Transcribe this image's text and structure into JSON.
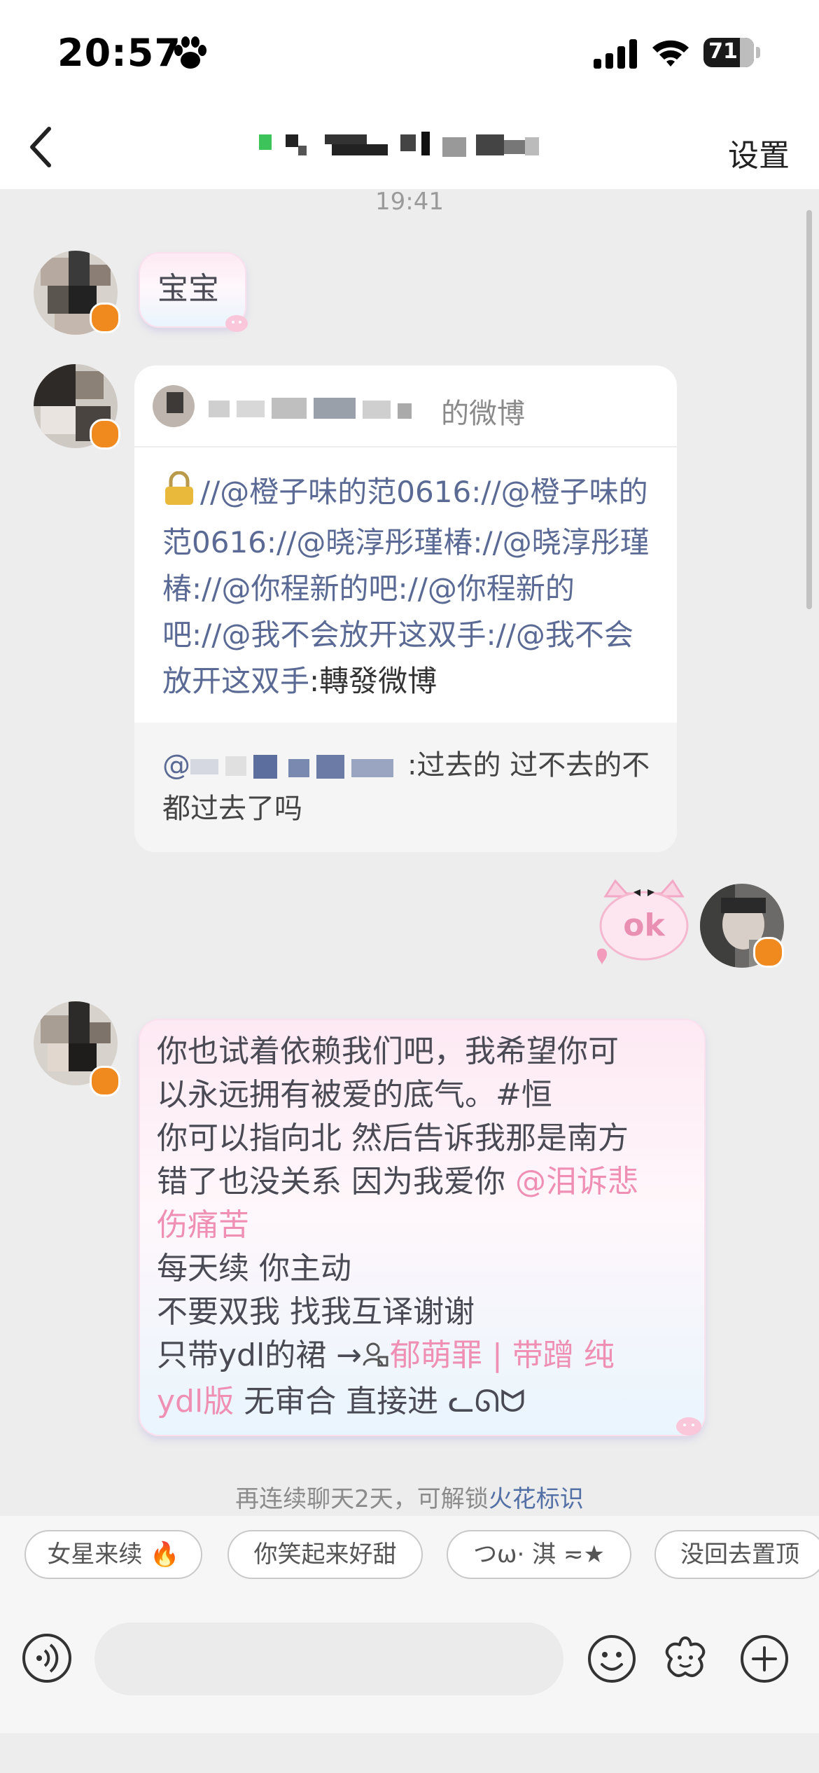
{
  "status_bar": {
    "time": "20:57",
    "battery": "71"
  },
  "nav": {
    "settings_label": "设置"
  },
  "chat": {
    "timestamp": "19:41",
    "msg1": "宝宝",
    "share": {
      "header": "的微博",
      "body_links": "//@橙子味的范0616://@橙子味的范0616://@晓淳彤瑾椿://@晓淳彤瑾椿://@你程新的吧://@你程新的吧://@我不会放开这双手://@我不会放开这双手",
      "body_plain": ":轉發微博",
      "footer_mention": "@",
      "footer_text": ":过去的 过不去的不都过去了吗"
    },
    "ok_sticker": "ok",
    "msg3": {
      "line1": "你也试着依赖我们吧，我希望你可",
      "line2": "以永远拥有被爱的底气。#恒",
      "line3": "你可以指向北 然后告诉我那是南方",
      "line4a": "错了也没关系 因为我爱你 ",
      "line4b": "@泪诉悲",
      "line5": "伤痛苦",
      "line6": "每天续 你主动",
      "line7": "不要双我 找我互译谢谢",
      "line8a": "只带ydl的裙 →",
      "line8b": "郁萌罪 | 带蹭 纯",
      "line9a": "ydl版",
      "line9b": " 无审合 直接进 ᓚᘏᗢ"
    },
    "hint_prefix": "再连续聊天2天，可解锁",
    "hint_link": "火花标识"
  },
  "quick_replies": [
    "女星来续 🔥",
    "你笑起来好甜",
    "つω· 淇 ≂★",
    "没回去置顶"
  ],
  "colors": {
    "accent_pink": "#ef8fb3",
    "link_blue": "#5a6a94",
    "badge_orange": "#f08a1e"
  }
}
